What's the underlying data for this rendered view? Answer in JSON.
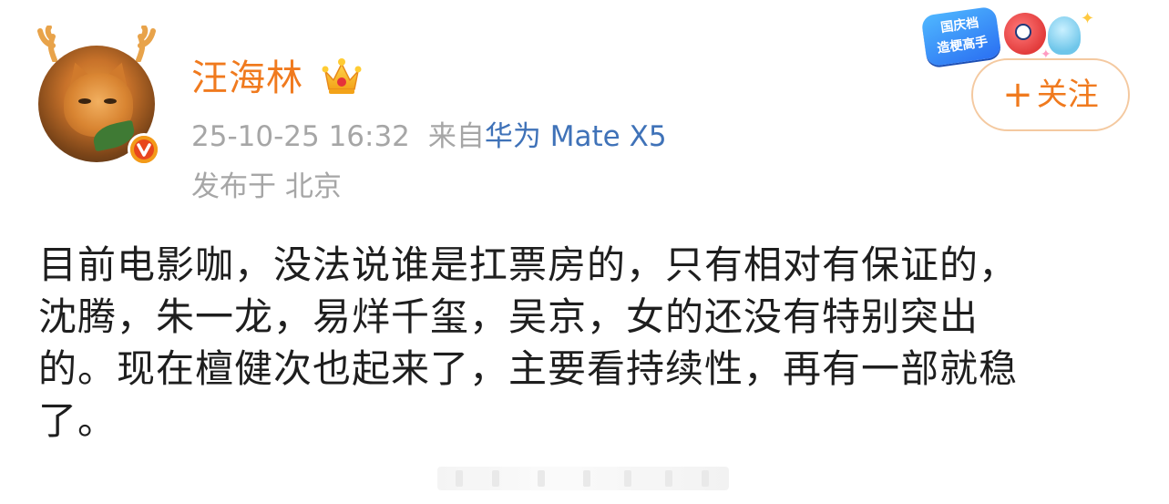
{
  "user": {
    "name": "汪海林",
    "verified": true,
    "crown_icon": "crown-icon",
    "avatar_icon": "cat-avatar"
  },
  "post_meta": {
    "timestamp": "25-10-25 16:32",
    "source_prefix": "来自",
    "source_device": "华为 Mate X5",
    "location": "发布于 北京"
  },
  "follow_button": {
    "plus": "+",
    "label": "关注"
  },
  "promo": {
    "line1": "国庆档",
    "line2": "造梗高手"
  },
  "content": {
    "lines": [
      "目前电影咖，没法说谁是扛票房的，只有相对有保证的，",
      "沈腾，朱一龙，易烊千玺，吴京，女的还没有特别突出",
      "的。现在檀健次也起来了，主要看持续性，再有一部就稳",
      "了。"
    ]
  },
  "colors": {
    "username": "#f07a1e",
    "meta": "#a6a6a6",
    "source_link": "#3f72b8",
    "body_text": "#1e1e1e",
    "follow_border": "#f4c9a0"
  }
}
